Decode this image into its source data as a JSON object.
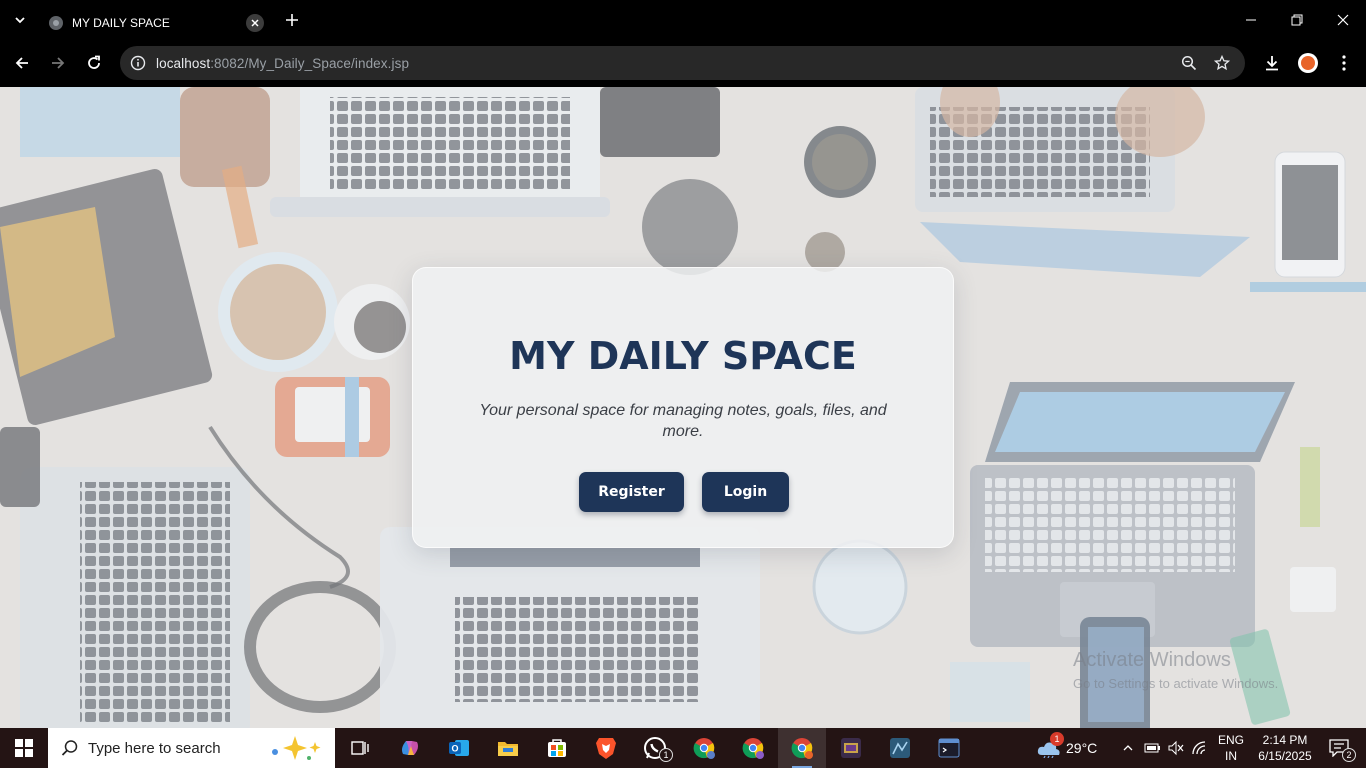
{
  "browser": {
    "tab_title": "MY DAILY SPACE",
    "url_host": "localhost",
    "url_path": ":8082/My_Daily_Space/index.jsp"
  },
  "page": {
    "title": "MY DAILY SPACE",
    "tagline": "Your personal space for managing notes, goals, files, and more.",
    "register_label": "Register",
    "login_label": "Login",
    "watermark_line1": "Activate Windows",
    "watermark_line2": "Go to Settings to activate Windows."
  },
  "taskbar": {
    "search_placeholder": "Type here to search",
    "weather_temp": "29°C",
    "weather_badge": "1",
    "whatsapp_badge": "1",
    "lang_line1": "ENG",
    "lang_line2": "IN",
    "time": "2:14 PM",
    "date": "6/15/2025",
    "notification_count": "2"
  },
  "colors": {
    "brand_navy": "#1e3558",
    "chrome_bg": "#000000",
    "omnibox_bg": "#282828",
    "taskbar_bg": "#241414"
  }
}
